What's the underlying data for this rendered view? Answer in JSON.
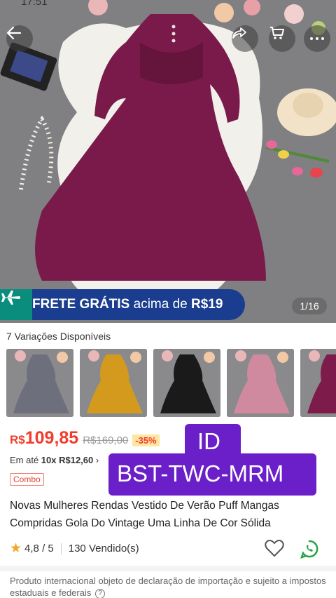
{
  "status_bar": {
    "time": "17:51"
  },
  "gallery": {
    "pager": "1/16",
    "shipping_banner": {
      "bold": "FRETE GRÁTIS",
      "regular": " acima de ",
      "amount": "R$19"
    },
    "dress_color": "#7a1a4a"
  },
  "variations": {
    "title": "7 Variações Disponíveis",
    "items": [
      {
        "icon": "dress-thumbnail-gray",
        "color": "#6e6f7c"
      },
      {
        "icon": "dress-thumbnail-yellow",
        "color": "#d39a1e"
      },
      {
        "icon": "dress-thumbnail-black",
        "color": "#1a1a1a"
      },
      {
        "icon": "dress-thumbnail-pink",
        "color": "#d08aa0"
      },
      {
        "icon": "dress-thumbnail-purple",
        "color": "#7d1c4a"
      }
    ]
  },
  "price": {
    "currency": "R$",
    "value": "109,85",
    "original": "R$169,00",
    "discount": "-35%"
  },
  "installment": {
    "prefix": "Em até ",
    "bold": "10x R$12,60",
    "chevron": " ›"
  },
  "combo_label": "Combo",
  "overlay_id": {
    "line1": "ID",
    "line2": "BST-TWC-MRM"
  },
  "product_title": "Novas Mulheres Rendas Vestido De Verão Puff Mangas Compridas Gola Do Vintage Uma Linha De Cor Sólida",
  "rating": {
    "score": "4,8 / 5",
    "sold": "130 Vendido(s)"
  },
  "notice": "Produto internacional objeto de declaração de importação e sujeito a impostos estaduais e federais",
  "colors": {
    "accent": "#f23c2c",
    "banner": "#1b3d8f",
    "id_overlay": "#6a1fc9",
    "whatsapp": "#25a244"
  }
}
